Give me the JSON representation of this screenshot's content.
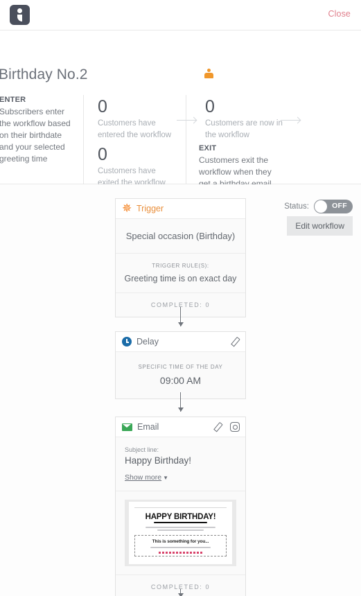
{
  "topbar": {
    "logo_icon": "app-logo-icon",
    "close_label": "Close"
  },
  "summary": {
    "workflow_title": "Birthday No.2",
    "audience_icon": "person-icon",
    "enter": {
      "label": "ENTER",
      "text": "Subscribers enter the workflow based on their birthdate and your selected greeting time"
    },
    "exit": {
      "label": "EXIT",
      "text": "Customers exit the workflow when they get a birthday email"
    },
    "stats": [
      {
        "value": "0",
        "caption": "Customers have entered the workflow"
      },
      {
        "value": "0",
        "caption": "Customers have exited the workflow"
      },
      {
        "value": "0",
        "caption": "Customers are now in the workflow"
      }
    ]
  },
  "controls": {
    "status_label": "Status:",
    "status_value": "OFF",
    "status_on": false,
    "edit_workflow_label": "Edit workflow"
  },
  "workflow": {
    "trigger": {
      "icon": "star-burst-icon",
      "title": "Trigger",
      "main": "Special occasion (Birthday)",
      "rules_caption": "TRIGGER RULE(S):",
      "rules_value": "Greeting time is on exact day",
      "completed": "COMPLETED: 0"
    },
    "delay": {
      "icon": "clock-icon",
      "title": "Delay",
      "edit_icon": "pencil-icon",
      "caption": "SPECIFIC TIME OF THE DAY",
      "value": "09:00 AM"
    },
    "email": {
      "icon": "mail-icon",
      "title": "Email",
      "edit_icon": "pencil-icon",
      "settings_icon": "gear-icon",
      "subject_caption": "Subject line:",
      "subject_value": "Happy Birthday!",
      "show_more_label": "Show more",
      "preview": {
        "headline": "HAPPY BIRTHDAY!",
        "box_title": "This is something for you..."
      },
      "completed": "COMPLETED: 0"
    }
  },
  "colors": {
    "accent_orange": "#f58220",
    "close_red": "#e07f8c",
    "email_green": "#3aa757",
    "delay_blue": "#1b6ca8"
  }
}
